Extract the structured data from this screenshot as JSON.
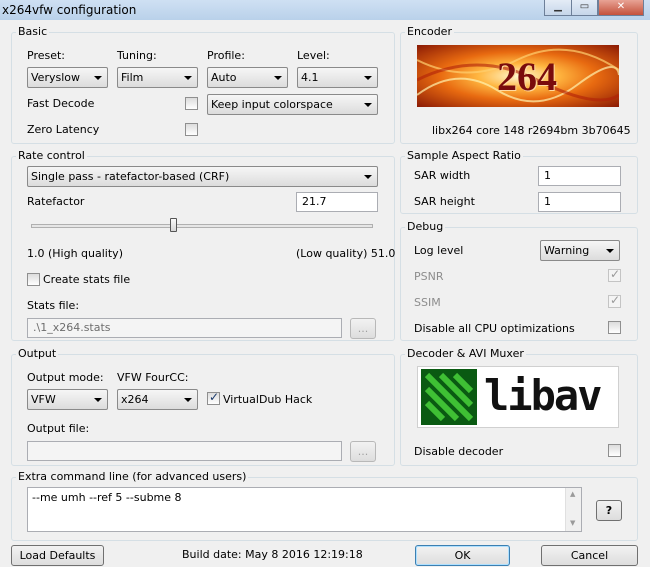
{
  "window": {
    "title": "x264vfw configuration"
  },
  "basic": {
    "label": "Basic",
    "preset_label": "Preset:",
    "preset": "Veryslow",
    "tuning_label": "Tuning:",
    "tuning": "Film",
    "profile_label": "Profile:",
    "profile": "Auto",
    "level_label": "Level:",
    "level": "4.1",
    "fast_decode_label": "Fast Decode",
    "fast_decode": false,
    "colorspace": "Keep input colorspace",
    "zero_latency_label": "Zero Latency",
    "zero_latency": false
  },
  "encoder": {
    "label": "Encoder",
    "logo_text": "264",
    "version": "libx264 core 148 r2694bm 3b70645"
  },
  "rate_control": {
    "label": "Rate control",
    "mode": "Single pass - ratefactor-based (CRF)",
    "ratefactor_label": "Ratefactor",
    "ratefactor": "21.7",
    "slider_value": 21.7,
    "slider_min": 1.0,
    "slider_max": 51.0,
    "min_label": "1.0 (High quality)",
    "max_label": "(Low quality) 51.0",
    "create_stats_label": "Create stats file",
    "create_stats": false,
    "stats_file_label": "Stats file:",
    "stats_file": ".\\1_x264.stats",
    "browse_label": "..."
  },
  "sar": {
    "label": "Sample Aspect Ratio",
    "width_label": "SAR width",
    "width": "1",
    "height_label": "SAR height",
    "height": "1"
  },
  "debug": {
    "label": "Debug",
    "log_level_label": "Log level",
    "log_level": "Warning",
    "psnr_label": "PSNR",
    "psnr": true,
    "ssim_label": "SSIM",
    "ssim": true,
    "disable_cpu_label": "Disable all CPU optimizations",
    "disable_cpu": false
  },
  "output": {
    "label": "Output",
    "mode_label": "Output mode:",
    "mode": "VFW",
    "fourcc_label": "VFW FourCC:",
    "fourcc": "x264",
    "vdub_hack_label": "VirtualDub Hack",
    "vdub_hack": true,
    "file_label": "Output file:",
    "file": "",
    "browse_label": "..."
  },
  "decoder": {
    "label": "Decoder & AVI Muxer",
    "logo_text": "libav",
    "disable_decoder_label": "Disable decoder",
    "disable_decoder": false
  },
  "extra": {
    "label": "Extra command line (for advanced users)",
    "value": "--me umh --ref 5 --subme 8",
    "help_label": "?"
  },
  "footer": {
    "load_defaults": "Load Defaults",
    "build_date": "Build date: May  8 2016 12:19:18",
    "ok": "OK",
    "cancel": "Cancel"
  }
}
